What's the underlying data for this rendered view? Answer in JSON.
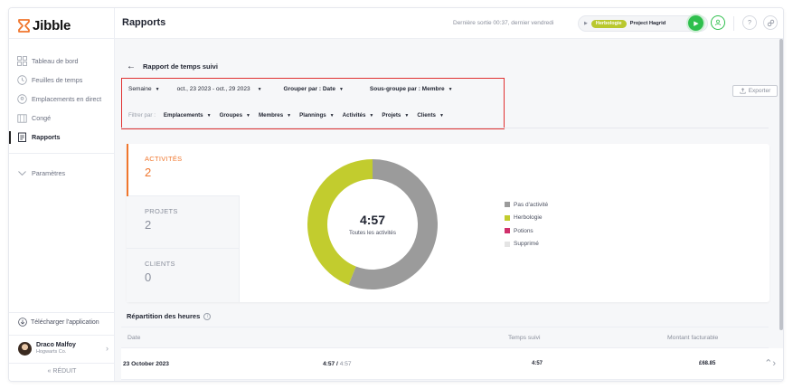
{
  "brand": {
    "name": "Jibble"
  },
  "sidebar": {
    "items": [
      {
        "label": "Tableau de bord",
        "icon": "dashboard-icon",
        "active": false
      },
      {
        "label": "Feuilles de temps",
        "icon": "clock-icon",
        "active": false
      },
      {
        "label": "Emplacements en direct",
        "icon": "location-pin-icon",
        "active": false
      },
      {
        "label": "Congé",
        "icon": "calendar-icon",
        "active": false
      },
      {
        "label": "Rapports",
        "icon": "report-icon",
        "active": true
      }
    ],
    "settings_label": "Paramètres",
    "download_label": "Télécharger l'application",
    "user": {
      "name": "Draco Malfoy",
      "org": "Hogwarts Co."
    },
    "reduce_label": "« RÉDUIT"
  },
  "header": {
    "title": "Rapports",
    "last_out": "Dernière sortie 00:37, dernier vendredi",
    "timer": {
      "activity_tag": "Herbologie",
      "project": "Project Hagrid"
    },
    "accent_color": "#2fbf4d"
  },
  "report": {
    "back_title": "Rapport de temps suivi",
    "period_type": "Semaine",
    "date_range": "oct., 23 2023 - oct., 29 2023",
    "group_by": "Grouper par : Date",
    "subgroup_by": "Sous-groupe par : Membre",
    "filter_label": "Filtrer par :",
    "filters": [
      "Emplacements",
      "Groupes",
      "Membres",
      "Plannings",
      "Activités",
      "Projets",
      "Clients"
    ],
    "export_label": "Exporter"
  },
  "stats": [
    {
      "label": "ACTIVITÉS",
      "value": "2",
      "active": true
    },
    {
      "label": "PROJETS",
      "value": "2",
      "active": false
    },
    {
      "label": "CLIENTS",
      "value": "0",
      "active": false
    }
  ],
  "chart_data": {
    "type": "pie",
    "center_value": "4:57",
    "center_label": "Toutes les activités",
    "categories": [
      "Pas d'activité",
      "Herbologie",
      "Potions",
      "Supprimé"
    ],
    "values": [
      56,
      44,
      0,
      0
    ],
    "colors": [
      "#9b9b9b",
      "#c2cc2e",
      "#d0306b",
      "#e4e4e4"
    ]
  },
  "breakdown": {
    "title": "Répartition des heures",
    "columns": [
      "Date",
      "Temps suivi",
      "Montant facturable"
    ],
    "rows": [
      {
        "date": "23 October 2023",
        "tracked": "4:57",
        "total": "4:57",
        "tracked_col": "4:57",
        "billable": "£68.85"
      }
    ]
  }
}
